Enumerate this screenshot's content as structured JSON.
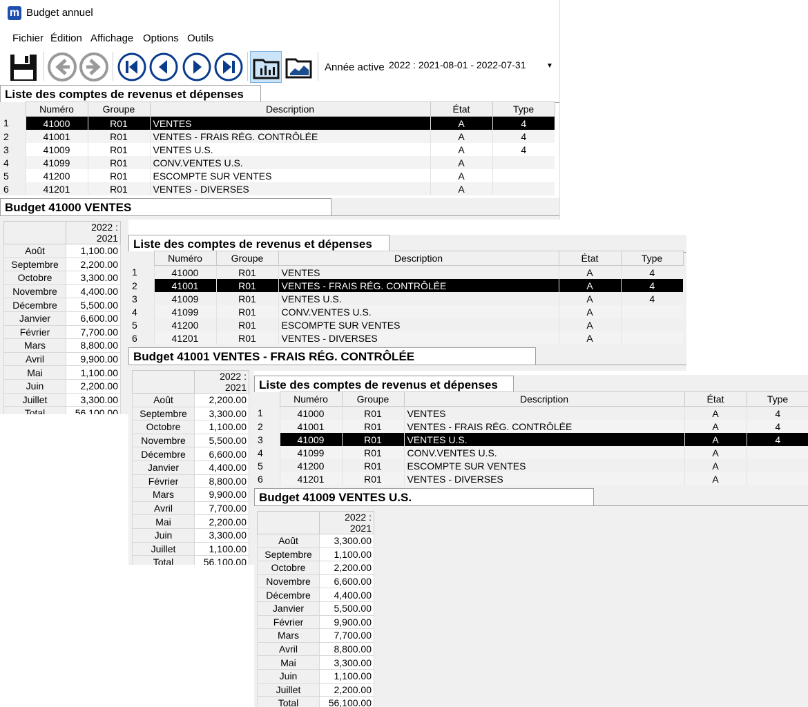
{
  "window": {
    "logo": "m",
    "title": "Budget annuel"
  },
  "menu": [
    "Fichier",
    "Édition",
    "Affichage",
    "Options",
    "Outils"
  ],
  "toolbar": {
    "icons": [
      "save-icon",
      "back-arrow-icon",
      "forward-arrow-icon",
      "first-record-icon",
      "previous-record-icon",
      "next-record-icon",
      "last-record-icon",
      "folder-chart-icon",
      "folder-graph-icon"
    ],
    "year_label": "Année active",
    "year_value": "2022 :  2021-08-01 - 2022-07-31"
  },
  "columns": [
    "Numéro",
    "Groupe",
    "Description",
    "État",
    "Type"
  ],
  "accounts_heading": "Liste des comptes de revenus et dépenses",
  "accounts": [
    {
      "n": "1",
      "numero": "41000",
      "groupe": "R01",
      "description": "VENTES",
      "etat": "A",
      "type": "4"
    },
    {
      "n": "2",
      "numero": "41001",
      "groupe": "R01",
      "description": "VENTES - FRAIS RÉG. CONTRÔLÉE",
      "etat": "A",
      "type": "4"
    },
    {
      "n": "3",
      "numero": "41009",
      "groupe": "R01",
      "description": "VENTES U.S.",
      "etat": "A",
      "type": "4"
    },
    {
      "n": "4",
      "numero": "41099",
      "groupe": "R01",
      "description": "CONV.VENTES U.S.",
      "etat": "A",
      "type": ""
    },
    {
      "n": "5",
      "numero": "41200",
      "groupe": "R01",
      "description": "ESCOMPTE SUR VENTES",
      "etat": "A",
      "type": ""
    },
    {
      "n": "6",
      "numero": "41201",
      "groupe": "R01",
      "description": "VENTES - DIVERSES",
      "etat": "A",
      "type": ""
    }
  ],
  "budget_year_header": "2022 :  2021",
  "months": [
    "Août",
    "Septembre",
    "Octobre",
    "Novembre",
    "Décembre",
    "Janvier",
    "Février",
    "Mars",
    "Avril",
    "Mai",
    "Juin",
    "Juillet",
    "Total"
  ],
  "panels": [
    {
      "budget_title": "Budget 41000 VENTES",
      "selected_row": 0,
      "values": [
        "1,100.00",
        "2,200.00",
        "3,300.00",
        "4,400.00",
        "5,500.00",
        "6,600.00",
        "7,700.00",
        "8,800.00",
        "9,900.00",
        "1,100.00",
        "2,200.00",
        "3,300.00",
        "56,100.00"
      ]
    },
    {
      "budget_title": "Budget 41001 VENTES - FRAIS RÉG. CONTRÔLÉE",
      "selected_row": 1,
      "values": [
        "2,200.00",
        "3,300.00",
        "1,100.00",
        "5,500.00",
        "6,600.00",
        "4,400.00",
        "8,800.00",
        "9,900.00",
        "7,700.00",
        "2,200.00",
        "3,300.00",
        "1,100.00",
        "56,100.00"
      ]
    },
    {
      "budget_title": "Budget 41009 VENTES U.S.",
      "selected_row": 2,
      "values": [
        "3,300.00",
        "1,100.00",
        "2,200.00",
        "6,600.00",
        "4,400.00",
        "5,500.00",
        "9,900.00",
        "7,700.00",
        "8,800.00",
        "3,300.00",
        "1,100.00",
        "2,200.00",
        "56,100.00"
      ]
    }
  ]
}
